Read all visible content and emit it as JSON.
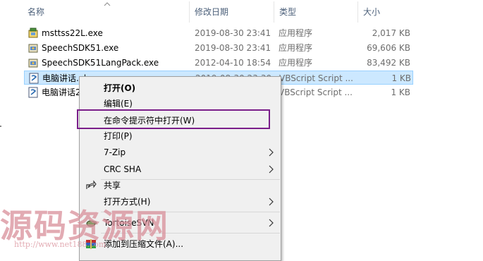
{
  "columns": {
    "name": "名称",
    "modified": "修改日期",
    "type": "类型",
    "size": "大小"
  },
  "files": [
    {
      "name": "msttss22L.exe",
      "date": "2019-08-30 23:41",
      "type": "应用程序",
      "size": "2,017 KB",
      "icon": "installer-icon"
    },
    {
      "name": "SpeechSDK51.exe",
      "date": "2019-08-30 23:41",
      "type": "应用程序",
      "size": "69,606 KB",
      "icon": "installer-icon"
    },
    {
      "name": "SpeechSDK51LangPack.exe",
      "date": "2012-04-10 18:54",
      "type": "应用程序",
      "size": "83,492 KB",
      "icon": "installer-icon"
    },
    {
      "name": "电脑讲话.vbs",
      "date": "2019-08-30 23:30",
      "type": "VBScript Script ...",
      "size": "1 KB",
      "icon": "vbscript-icon",
      "selected": true
    },
    {
      "name": "电脑讲话2",
      "date": "",
      "type": "VBScript Script ...",
      "size": "1 KB",
      "icon": "vbscript-icon"
    }
  ],
  "context_menu": {
    "open": "打开(O)",
    "edit": "编辑(E)",
    "open_in_cmd": "在命令提示符中打开(W)",
    "print": "打印(P)",
    "seven_zip": "7-Zip",
    "crc_sha": "CRC SHA",
    "share": "共享",
    "open_with": "打开方式(H)",
    "tortoise_svn": "TortoiseSVN",
    "add_to_archive": "添加到压缩文件(A)..."
  },
  "watermark": {
    "text": "源码资源网",
    "url": "http://www.net188.com"
  },
  "colors": {
    "selection_bg": "#cce8ff",
    "highlight_border": "#7a1e8a",
    "watermark": "#d98f9a"
  }
}
